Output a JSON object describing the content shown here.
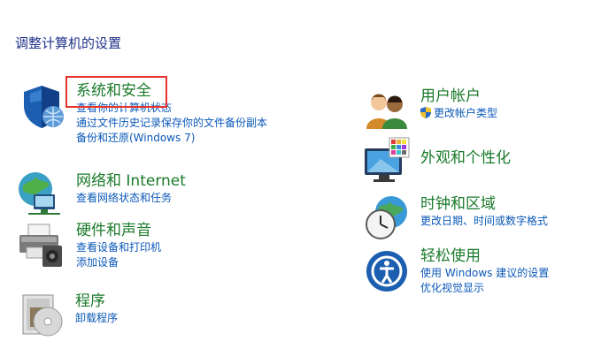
{
  "page": {
    "title": "调整计算机的设置"
  },
  "categories": {
    "system_security": {
      "title": "系统和安全",
      "links": [
        "查看你的计算机状态",
        "通过文件历史记录保存你的文件备份副本",
        "备份和还原(Windows 7)"
      ]
    },
    "network": {
      "title": "网络和 Internet",
      "links": [
        "查看网络状态和任务"
      ]
    },
    "hardware": {
      "title": "硬件和声音",
      "links": [
        "查看设备和打印机",
        "添加设备"
      ]
    },
    "programs": {
      "title": "程序",
      "links": [
        "卸载程序"
      ]
    },
    "user_accounts": {
      "title": "用户帐户",
      "links": [
        "更改帐户类型"
      ]
    },
    "appearance": {
      "title": "外观和个性化",
      "links": []
    },
    "clock_region": {
      "title": "时钟和区域",
      "links": [
        "更改日期、时间或数字格式"
      ]
    },
    "ease_access": {
      "title": "轻松使用",
      "links": [
        "使用 Windows 建议的设置",
        "优化视觉显示"
      ]
    }
  },
  "colors": {
    "title_blue": "#1e3287",
    "category_green": "#1a7a2a",
    "link_blue": "#0a58b8",
    "highlight_red": "#e8332c"
  },
  "icons": {
    "system_security": "shield-icon",
    "network": "network-globe-icon",
    "hardware": "printer-icon",
    "programs": "programs-disc-icon",
    "user_accounts": "users-icon",
    "appearance": "display-palette-icon",
    "clock_region": "clock-globe-icon",
    "ease_access": "ease-of-access-icon",
    "uac": "uac-shield-icon"
  }
}
